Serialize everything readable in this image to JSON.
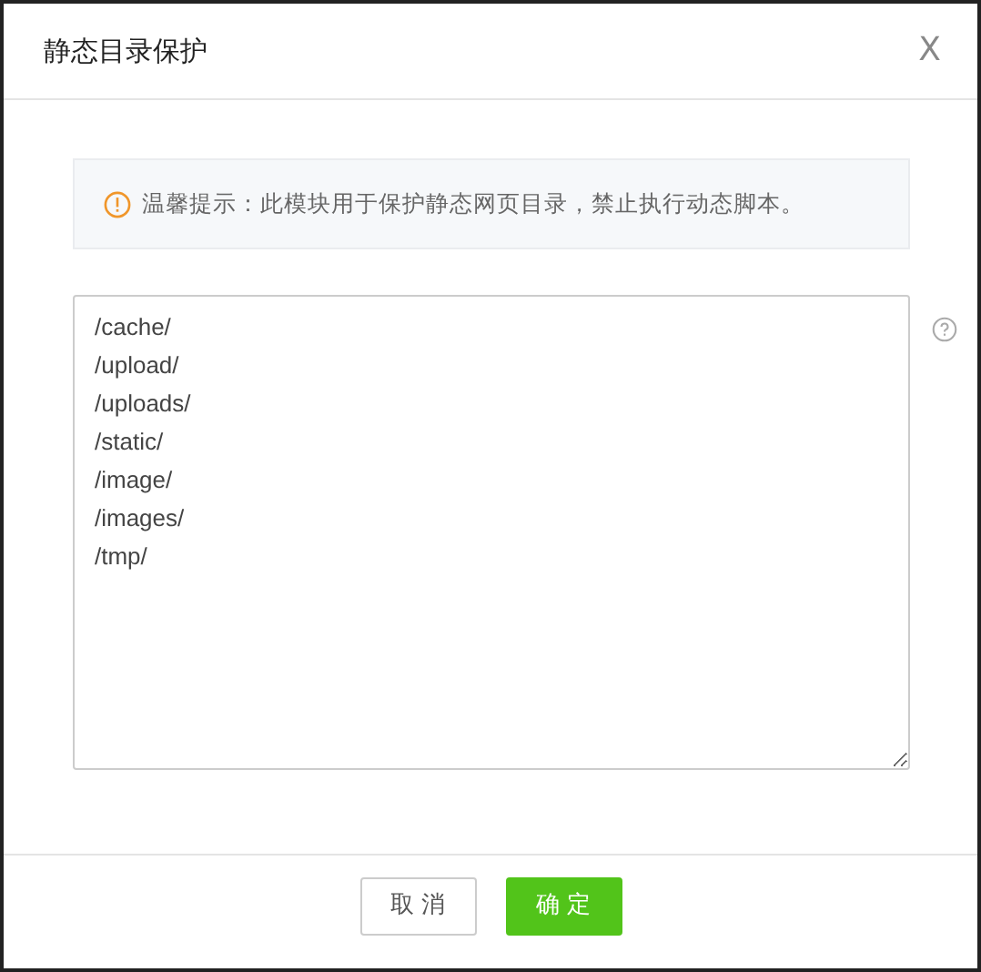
{
  "dialog": {
    "title": "静态目录保护",
    "close": "X"
  },
  "notice": {
    "text": "温馨提示：此模块用于保护静态网页目录，禁止执行动态脚本。"
  },
  "directories": [
    "/cache/",
    "/upload/",
    "/uploads/",
    "/static/",
    "/image/",
    "/images/",
    "/tmp/"
  ],
  "buttons": [
    {
      "label": "取 消",
      "kind": "secondary"
    },
    {
      "label": "确 定",
      "kind": "primary"
    }
  ]
}
